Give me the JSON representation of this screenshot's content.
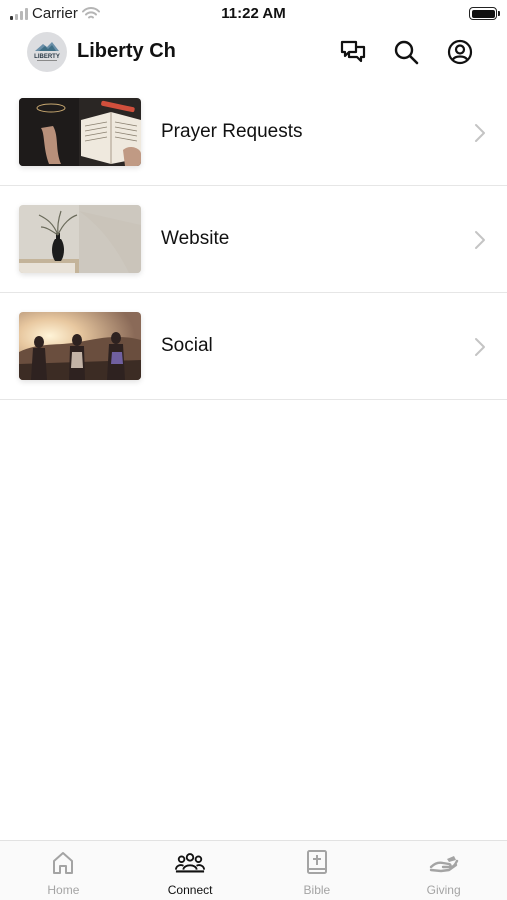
{
  "status_bar": {
    "carrier": "Carrier",
    "time": "11:22 AM"
  },
  "header": {
    "title": "Liberty Ch",
    "logo_text": "LIBERTY"
  },
  "list": {
    "items": [
      {
        "label": "Prayer Requests"
      },
      {
        "label": "Website"
      },
      {
        "label": "Social"
      }
    ]
  },
  "tabbar": {
    "active": "Connect",
    "tabs": [
      {
        "label": "Home",
        "icon": "home-icon"
      },
      {
        "label": "Connect",
        "icon": "people-icon"
      },
      {
        "label": "Bible",
        "icon": "bible-icon"
      },
      {
        "label": "Giving",
        "icon": "giving-hand-icon"
      }
    ]
  },
  "colors": {
    "active": "#111111",
    "inactive": "#a4a4a4",
    "divider": "#e6e6e6"
  }
}
